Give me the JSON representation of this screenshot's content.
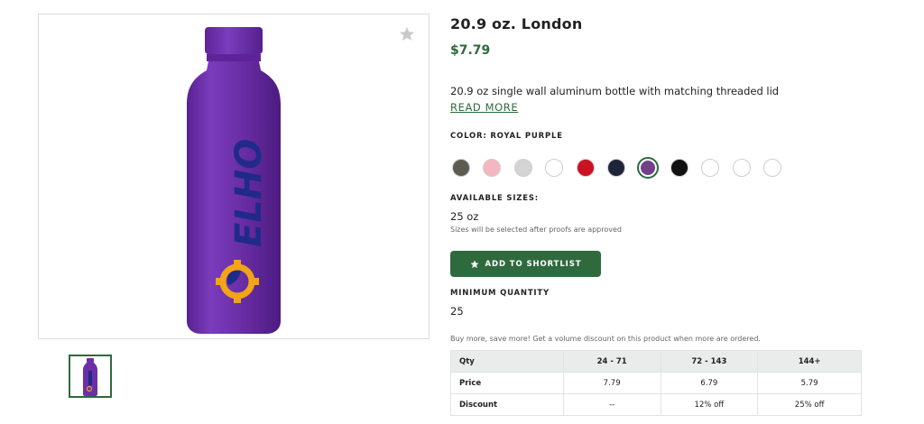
{
  "product": {
    "title": "20.9 oz. London",
    "price": "$7.79",
    "description": "20.9 oz single wall aluminum bottle with matching threaded lid",
    "read_more": "READ MORE",
    "image_icon": "favorite-star-icon",
    "bottle_logo_text": "ELHO",
    "bottle_color": "#6b2fa8",
    "logo_text_color": "#1f2a8a",
    "logo_gear_color": "#f2a516"
  },
  "color": {
    "label": "COLOR:",
    "selected_name": "ROYAL PURPLE",
    "swatches": [
      {
        "name": "gray",
        "hex": "#5b5b52"
      },
      {
        "name": "pink",
        "hex": "#f4b6c2"
      },
      {
        "name": "light-gray",
        "hex": "#d4d4d4"
      },
      {
        "name": "white",
        "hex": "#ffffff"
      },
      {
        "name": "red",
        "hex": "#cc1122"
      },
      {
        "name": "navy",
        "hex": "#1f2438"
      },
      {
        "name": "royal-purple",
        "hex": "#73408c",
        "selected": true
      },
      {
        "name": "black",
        "hex": "#111111"
      },
      {
        "name": "white-2",
        "hex": "#ffffff"
      },
      {
        "name": "white-3",
        "hex": "#ffffff"
      },
      {
        "name": "white-4",
        "hex": "#ffffff"
      }
    ]
  },
  "sizes": {
    "label": "AVAILABLE SIZES:",
    "value": "25 oz",
    "note": "Sizes will be selected after proofs are approved"
  },
  "shortlist": {
    "label": "ADD TO SHORTLIST",
    "icon": "star-icon"
  },
  "minimum": {
    "label": "MINIMUM QUANTITY",
    "value": "25"
  },
  "pricing": {
    "note": "Buy more, save more! Get a volume discount on this product when more are ordered.",
    "header": [
      "Qty",
      "24 - 71",
      "72 - 143",
      "144+"
    ],
    "rows": [
      [
        "Price",
        "7.79",
        "6.79",
        "5.79"
      ],
      [
        "Discount",
        "--",
        "12% off",
        "25% off"
      ]
    ]
  },
  "colors": {
    "brand_green": "#2e6a3e",
    "table_header_bg": "#e9ecea"
  }
}
